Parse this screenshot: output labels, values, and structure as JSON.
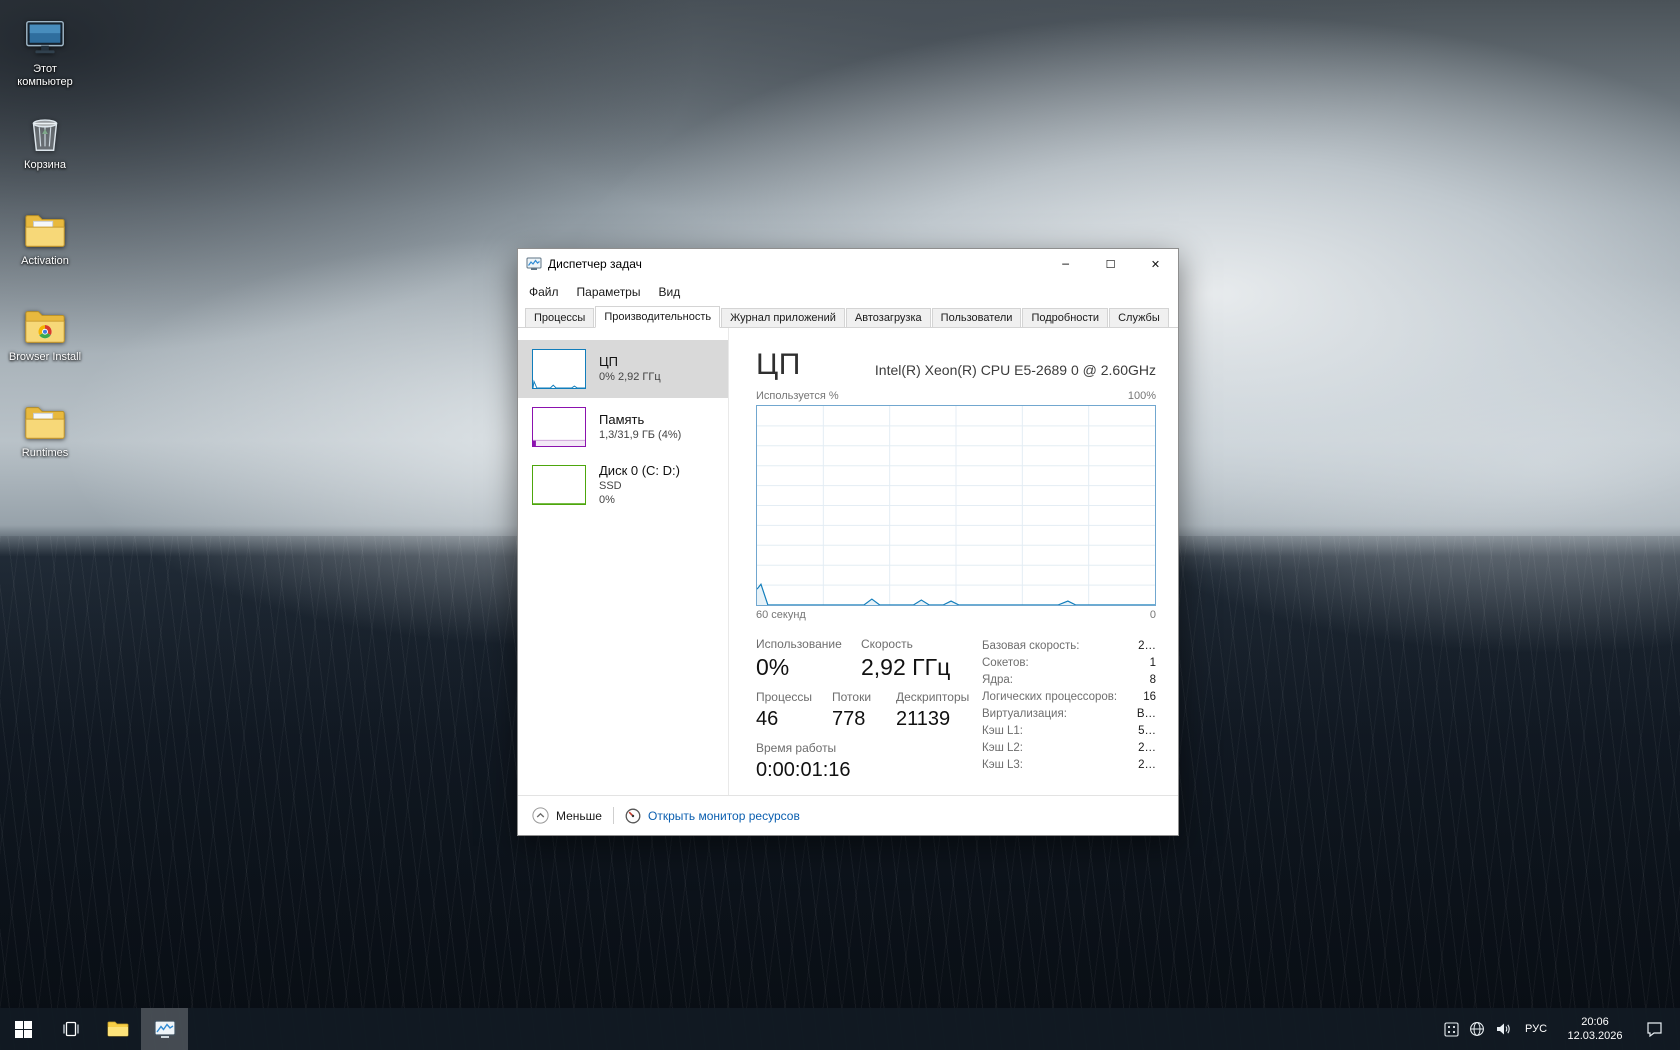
{
  "desktop": {
    "icons": [
      {
        "label": "Этот компьютер",
        "icon": "computer"
      },
      {
        "label": "Корзина",
        "icon": "recycle-bin"
      },
      {
        "label": "Activation",
        "icon": "folder"
      },
      {
        "label": "Browser Install",
        "icon": "folder-app"
      },
      {
        "label": "Runtimes",
        "icon": "folder"
      }
    ]
  },
  "window": {
    "title": "Диспетчер задач",
    "menus": [
      "Файл",
      "Параметры",
      "Вид"
    ],
    "controls": {
      "minimize": "─",
      "maximize": "☐",
      "close": "✕"
    },
    "tabs": [
      {
        "label": "Процессы",
        "active": false
      },
      {
        "label": "Производительность",
        "active": true
      },
      {
        "label": "Журнал приложений",
        "active": false
      },
      {
        "label": "Автозагрузка",
        "active": false
      },
      {
        "label": "Пользователи",
        "active": false
      },
      {
        "label": "Подробности",
        "active": false
      },
      {
        "label": "Службы",
        "active": false
      }
    ],
    "sidebar": [
      {
        "title": "ЦП",
        "subtitle": "0% 2,92 ГГц",
        "color": "#117dbb",
        "selected": true
      },
      {
        "title": "Память",
        "subtitle": "1,3/31,9 ГБ (4%)",
        "color": "#8b12ae",
        "selected": false
      },
      {
        "title": "Диск 0 (C: D:)",
        "subtitle": "SSD",
        "subtitle2": "0%",
        "color": "#4da60c",
        "selected": false
      }
    ],
    "cpu": {
      "title": "ЦП",
      "cpu_name": "Intel(R) Xeon(R) CPU E5-2689 0 @ 2.60GHz",
      "graph": {
        "top_left": "Используется %",
        "top_right": "100%",
        "bottom_left": "60 секунд",
        "bottom_right": "0"
      },
      "stats": [
        {
          "label": "Использование",
          "value": "0%"
        },
        {
          "label": "Скорость",
          "value": "2,92 ГГц"
        },
        {
          "label": "Процессы",
          "value": "46"
        },
        {
          "label": "Потоки",
          "value": "778"
        },
        {
          "label": "Дескрипторы",
          "value": "21139"
        },
        {
          "label": "Время работы",
          "value": "0:00:01:16"
        }
      ],
      "info": [
        {
          "label": "Базовая скорость:",
          "value": "2…"
        },
        {
          "label": "Сокетов:",
          "value": "1"
        },
        {
          "label": "Ядра:",
          "value": "8"
        },
        {
          "label": "Логических процессоров:",
          "value": "16"
        },
        {
          "label": "Виртуализация:",
          "value": "В…"
        },
        {
          "label": "Кэш L1:",
          "value": "5…"
        },
        {
          "label": "Кэш L2:",
          "value": "2…"
        },
        {
          "label": "Кэш L3:",
          "value": "2…"
        }
      ]
    },
    "footer": {
      "less_label": "Меньше",
      "link_label": "Открыть монитор ресурсов"
    }
  },
  "taskbar": {
    "language": "РУС",
    "time": "20:06",
    "date": "12.03.2026"
  },
  "colors": {
    "cpu_accent": "#117dbb",
    "memory_accent": "#8b12ae",
    "disk_accent": "#4da60c",
    "link": "#0b5fb0",
    "selected_item_bg": "#d9d9d9"
  },
  "chart_data": {
    "type": "area",
    "title": "ЦП — Используется %",
    "x_range_label": "60 секунд",
    "y_range": [
      0,
      100
    ],
    "description": "CPU usage over last 60 seconds, essentially idle near 0% with a small spike (~10%) at the oldest edge and tiny blips (~2-3%)",
    "approx_points_percent": [
      10,
      0,
      0,
      3,
      0,
      3,
      0,
      2,
      0,
      0,
      2,
      0
    ]
  }
}
